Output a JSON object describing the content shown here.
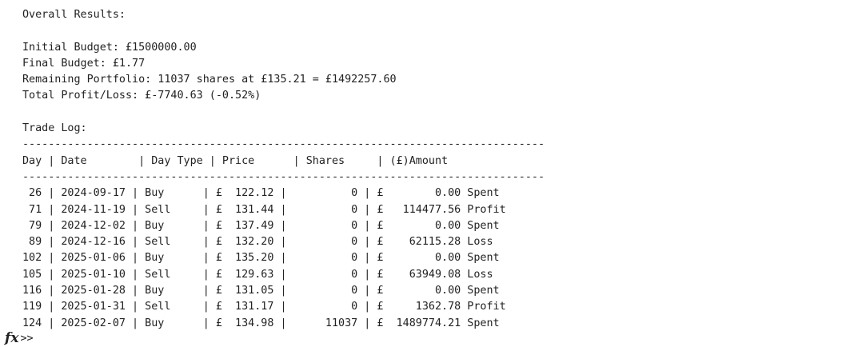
{
  "output": {
    "lines": [
      "Overall Results:",
      "",
      "Initial Budget: £1500000.00",
      "Final Budget: £1.77",
      "Remaining Portfolio: 11037 shares at £135.21 = £1492257.60",
      "Total Profit/Loss: £-7740.63 (-0.52%)",
      "",
      "Trade Log:",
      "---------------------------------------------------------------------------------",
      "Day | Date        | Day Type | Price      | Shares     | (£)Amount",
      "---------------------------------------------------------------------------------",
      " 26 | 2024-09-17 | Buy      | £  122.12 |          0 | £        0.00 Spent",
      " 71 | 2024-11-19 | Sell     | £  131.44 |          0 | £   114477.56 Profit",
      " 79 | 2024-12-02 | Buy      | £  137.49 |          0 | £        0.00 Spent",
      " 89 | 2024-12-16 | Sell     | £  132.20 |          0 | £    62115.28 Loss",
      "102 | 2025-01-06 | Buy      | £  135.20 |          0 | £        0.00 Spent",
      "105 | 2025-01-10 | Sell     | £  129.63 |          0 | £    63949.08 Loss",
      "116 | 2025-01-28 | Buy      | £  131.05 |          0 | £        0.00 Spent",
      "119 | 2025-01-31 | Sell     | £  131.17 |          0 | £     1362.78 Profit",
      "124 | 2025-02-07 | Buy      | £  134.98 |      11037 | £  1489774.21 Spent"
    ]
  },
  "prompt": {
    "fx_label": "fx",
    "chevrons": ">>"
  }
}
